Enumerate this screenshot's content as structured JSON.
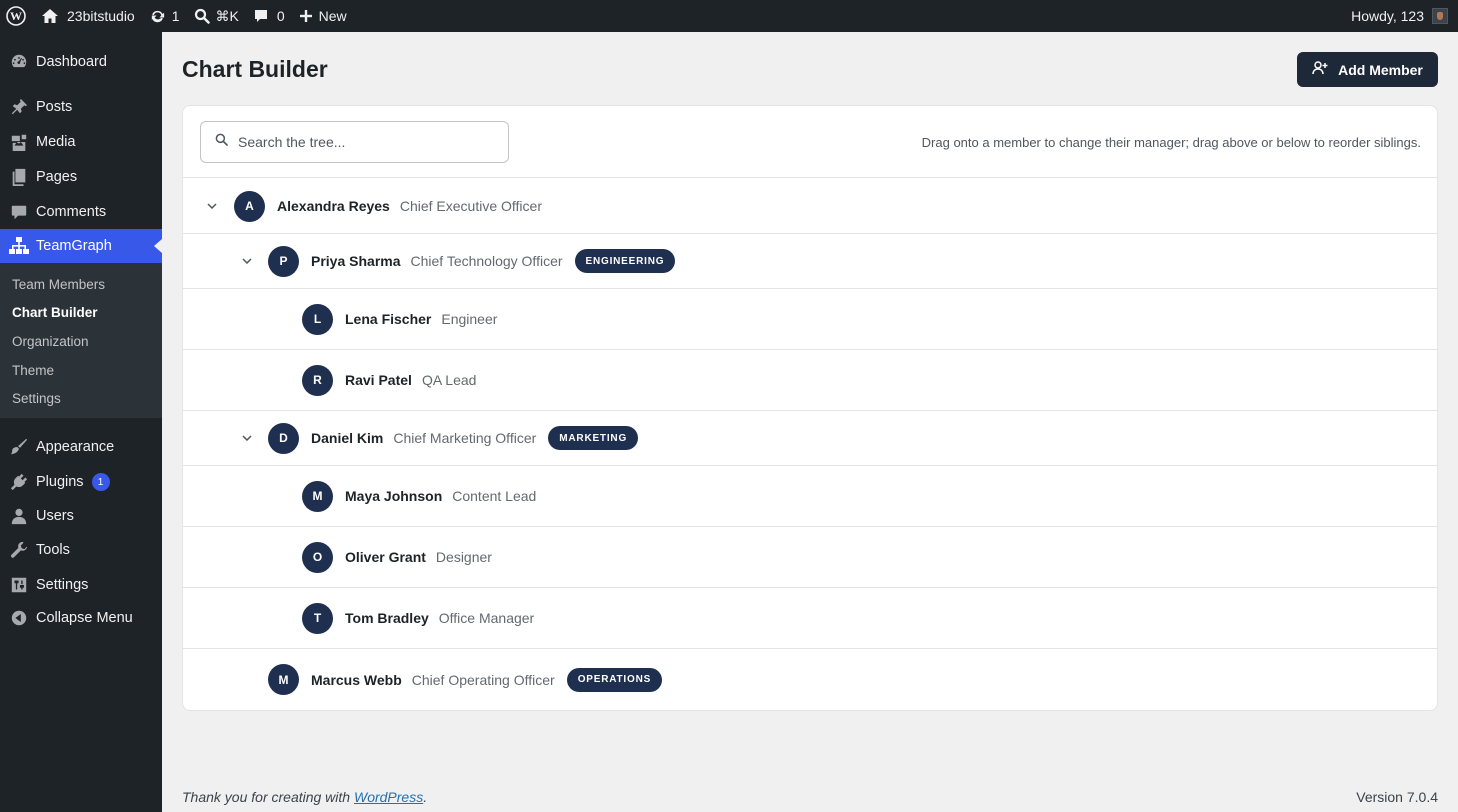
{
  "adminbar": {
    "site_name": "23bitstudio",
    "updates_count": "1",
    "search_shortcut": "⌘K",
    "comments_count": "0",
    "new_label": "New",
    "greeting": "Howdy, 123"
  },
  "sidebar": {
    "items": [
      {
        "label": "Dashboard",
        "icon": "dashboard-icon"
      },
      {
        "label": "Posts",
        "icon": "pin-icon"
      },
      {
        "label": "Media",
        "icon": "media-icon"
      },
      {
        "label": "Pages",
        "icon": "pages-icon"
      },
      {
        "label": "Comments",
        "icon": "comment-icon"
      },
      {
        "label": "TeamGraph",
        "icon": "sitemap-icon"
      },
      {
        "label": "Appearance",
        "icon": "brush-icon"
      },
      {
        "label": "Plugins",
        "icon": "plugin-icon",
        "badge": "1"
      },
      {
        "label": "Users",
        "icon": "user-icon"
      },
      {
        "label": "Tools",
        "icon": "wrench-icon"
      },
      {
        "label": "Settings",
        "icon": "settings-icon"
      },
      {
        "label": "Collapse Menu",
        "icon": "collapse-icon"
      }
    ],
    "submenu": [
      "Team Members",
      "Chart Builder",
      "Organization",
      "Theme",
      "Settings"
    ]
  },
  "page": {
    "title": "Chart Builder",
    "add_button": "Add Member",
    "search_placeholder": "Search the tree...",
    "drag_hint": "Drag onto a member to change their manager; drag above or below to reorder siblings."
  },
  "tree": [
    {
      "initial": "A",
      "name": "Alexandra Reyes",
      "role": "Chief Executive Officer",
      "dept": "",
      "level": 0,
      "expandable": true
    },
    {
      "initial": "P",
      "name": "Priya Sharma",
      "role": "Chief Technology Officer",
      "dept": "ENGINEERING",
      "level": 1,
      "expandable": true
    },
    {
      "initial": "L",
      "name": "Lena Fischer",
      "role": "Engineer",
      "dept": "",
      "level": 2,
      "expandable": false
    },
    {
      "initial": "R",
      "name": "Ravi Patel",
      "role": "QA Lead",
      "dept": "",
      "level": 2,
      "expandable": false
    },
    {
      "initial": "D",
      "name": "Daniel Kim",
      "role": "Chief Marketing Officer",
      "dept": "MARKETING",
      "level": 1,
      "expandable": true
    },
    {
      "initial": "M",
      "name": "Maya Johnson",
      "role": "Content Lead",
      "dept": "",
      "level": 2,
      "expandable": false
    },
    {
      "initial": "O",
      "name": "Oliver Grant",
      "role": "Designer",
      "dept": "",
      "level": 2,
      "expandable": false
    },
    {
      "initial": "T",
      "name": "Tom Bradley",
      "role": "Office Manager",
      "dept": "",
      "level": 2,
      "expandable": false
    },
    {
      "initial": "M",
      "name": "Marcus Webb",
      "role": "Chief Operating Officer",
      "dept": "OPERATIONS",
      "level": 1,
      "expandable": false
    }
  ],
  "footer": {
    "thanks_prefix": "Thank you for creating with ",
    "thanks_link": "WordPress",
    "thanks_suffix": ".",
    "version": "Version 7.0.4"
  }
}
